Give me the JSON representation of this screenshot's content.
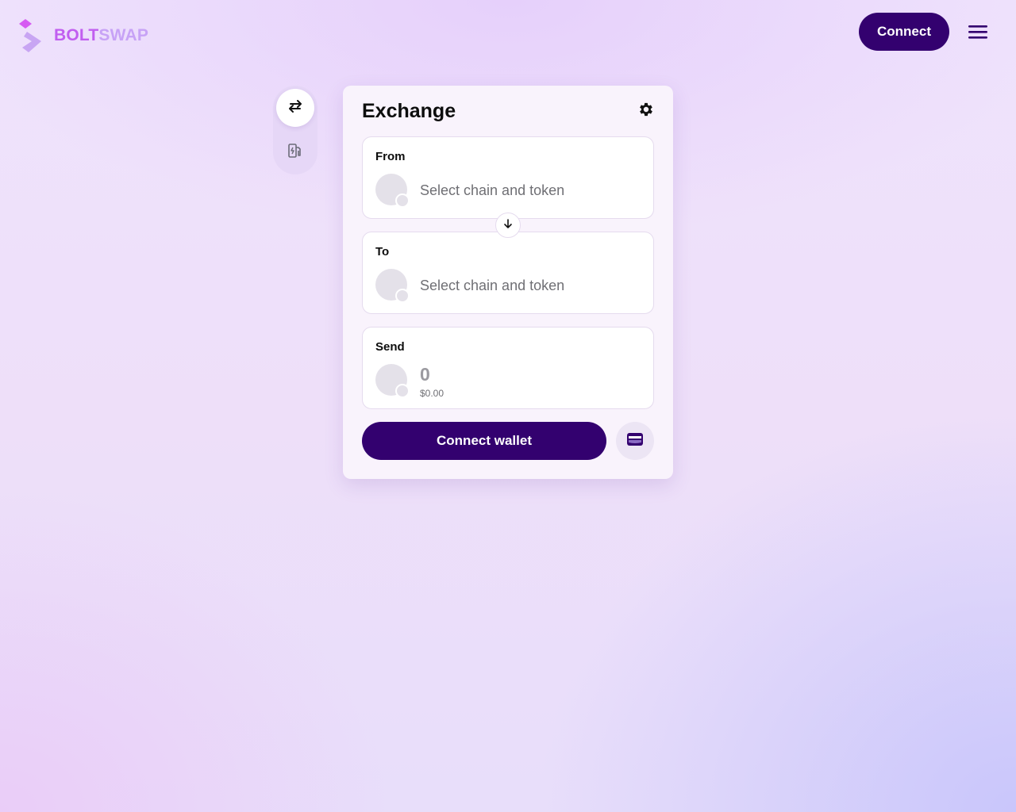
{
  "header": {
    "brand_part1": "BOLT",
    "brand_part2": "SWAP",
    "connect_label": "Connect"
  },
  "rail": {
    "items": [
      {
        "icon": "swap-arrows-icon",
        "active": true
      },
      {
        "icon": "gas-pump-icon",
        "active": false
      }
    ]
  },
  "exchange": {
    "title": "Exchange",
    "from": {
      "label": "From",
      "placeholder": "Select chain and token"
    },
    "to": {
      "label": "To",
      "placeholder": "Select chain and token"
    },
    "send": {
      "label": "Send",
      "amount": "0",
      "usd_value": "$0.00"
    },
    "connect_wallet_label": "Connect wallet"
  },
  "colors": {
    "primary": "#33016f",
    "brand_pink": "#c15ef0",
    "brand_lilac": "#c7a2f6"
  }
}
